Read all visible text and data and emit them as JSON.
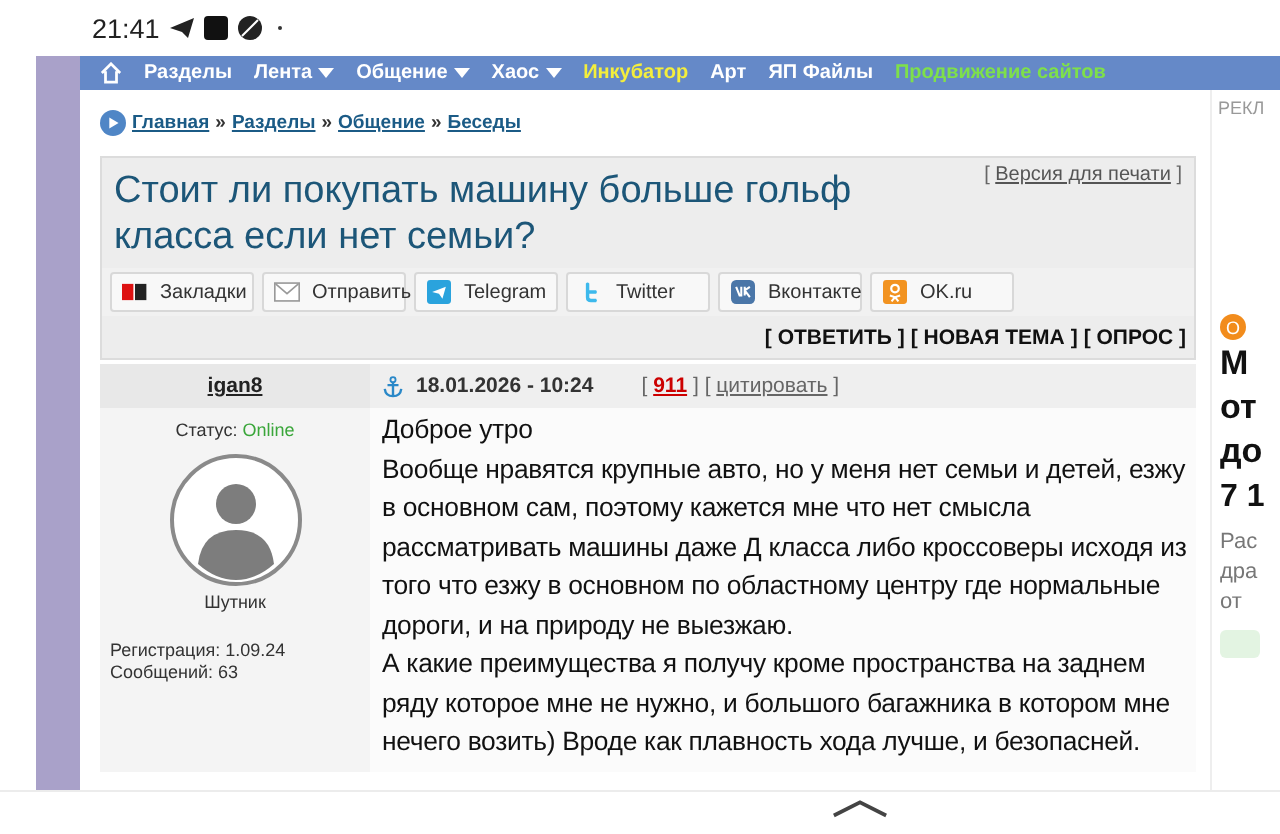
{
  "status_bar": {
    "time": "21:41"
  },
  "nav": {
    "items": [
      {
        "label": "Разделы",
        "dropdown": false,
        "color": "#ffffff"
      },
      {
        "label": "Лента",
        "dropdown": true,
        "color": "#ffffff"
      },
      {
        "label": "Общение",
        "dropdown": true,
        "color": "#ffffff"
      },
      {
        "label": "Хаос",
        "dropdown": true,
        "color": "#ffffff"
      },
      {
        "label": "Инкубатор",
        "dropdown": false,
        "color": "#f4ee3c"
      },
      {
        "label": "Арт",
        "dropdown": false,
        "color": "#ffffff"
      },
      {
        "label": "ЯП Файлы",
        "dropdown": false,
        "color": "#ffffff"
      },
      {
        "label": "Продвижение сайтов",
        "dropdown": false,
        "color": "#7ee04a"
      }
    ]
  },
  "breadcrumb": {
    "separator": "»",
    "items": [
      "Главная",
      "Разделы",
      "Общение",
      "Беседы"
    ]
  },
  "brackets": {
    "open": "[",
    "close": "]"
  },
  "topic": {
    "title": "Стоит ли покупать машину больше гольф класса если нет семьи?",
    "print_link": "Версия для печати",
    "share_buttons": [
      {
        "kind": "yap",
        "label": "Закладки"
      },
      {
        "kind": "mail",
        "label": "Отправить"
      },
      {
        "kind": "telegram",
        "label": "Telegram"
      },
      {
        "kind": "twitter",
        "label": "Twitter"
      },
      {
        "kind": "vk",
        "label": "Вконтакте"
      },
      {
        "kind": "ok",
        "label": "OK.ru"
      }
    ],
    "actions": [
      "ОТВЕТИТЬ",
      "НОВАЯ ТЕМА",
      "ОПРОС"
    ]
  },
  "post": {
    "author": "igan8",
    "status_label": "Статус:",
    "status_value": "Online",
    "rank": "Шутник",
    "registration": "Регистрация: 1.09.24",
    "messages": "Сообщений: 63",
    "date": "18.01.2026 - 10:24",
    "links": [
      {
        "kind": "number",
        "text": "911"
      },
      {
        "kind": "quote",
        "text": "цитировать"
      }
    ],
    "paragraphs": [
      "Доброе утро",
      "Вообще нравятся крупные авто, но у меня нет семьи и детей, езжу в основном сам, поэтому кажется мне что нет смысла рассматривать машины даже Д класса либо кроссоверы исходя из того что езжу в основном по областному центру где нормальные дороги, и на природу не выезжаю.",
      "А какие преимущества я получу кроме пространства на заднем ряду которое мне не нужно, и большого багажника в котором мне нечего возить) Вроде как плавность хода лучше, и безопасней."
    ]
  },
  "ad": {
    "label": "РЕКЛ",
    "badge": "О",
    "heading_lines": [
      "М",
      "от",
      "до"
    ],
    "price": "7 1",
    "small_lines": [
      "Рас",
      "дра",
      "от"
    ]
  }
}
